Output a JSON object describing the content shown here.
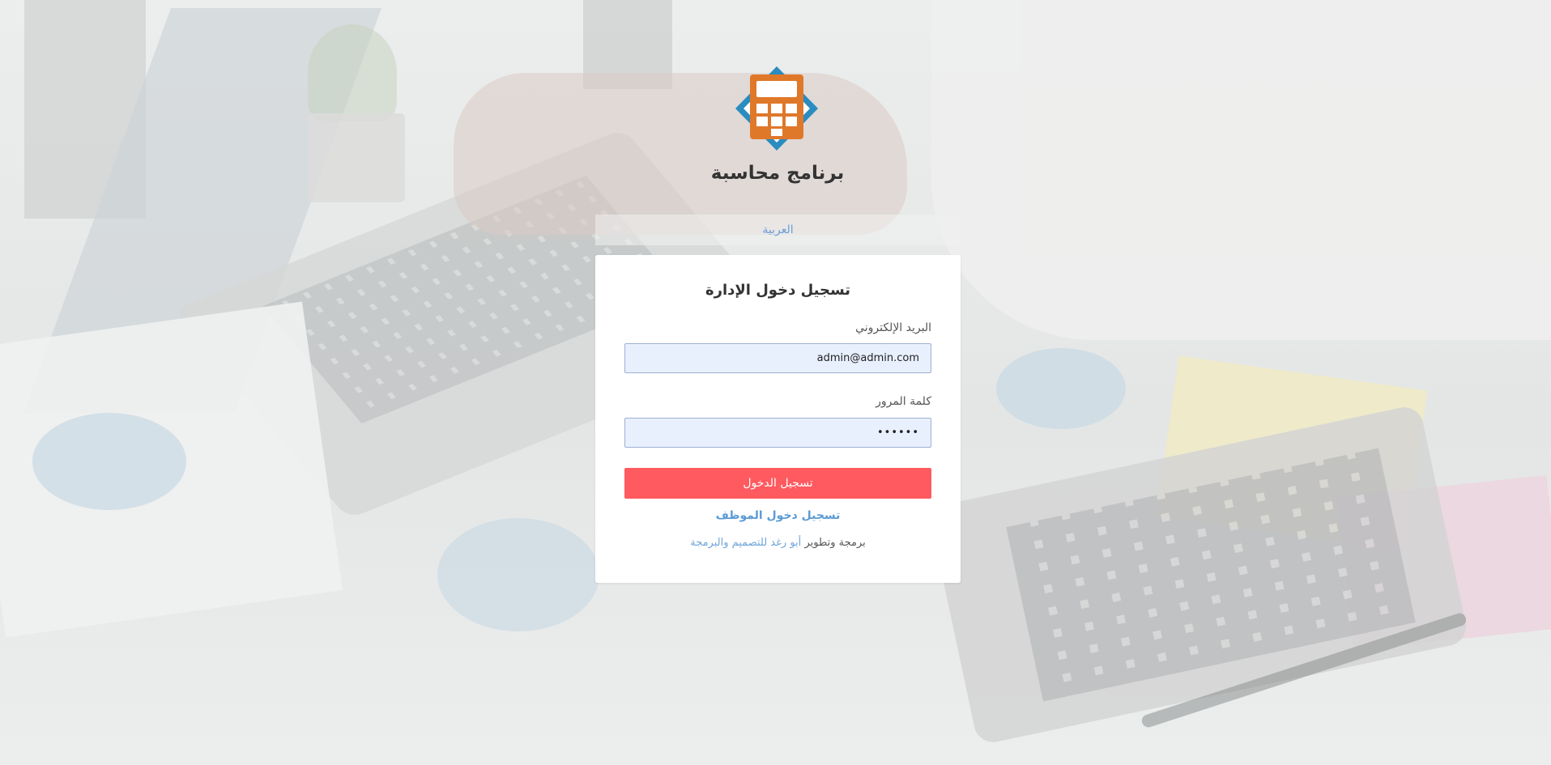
{
  "app": {
    "title": "برنامج محاسبة"
  },
  "language": {
    "current": "العربية"
  },
  "login": {
    "heading": "تسجيل دخول الإدارة",
    "email_label": "البريد الإلكتروني",
    "email_value": "admin@admin.com",
    "password_label": "كلمة المرور",
    "password_value": "••••••",
    "submit_label": "تسجيل الدخول",
    "employee_login_link": "تسجيل دخول الموظف"
  },
  "footer": {
    "prefix": "برمجة وتطوير",
    "developer_link": "أبو رغد للتصميم والبرمجة"
  },
  "colors": {
    "accent": "#ff5a5f",
    "link": "#5b9bd5",
    "logo_orange": "#e0782a",
    "logo_blue": "#2a8cbf"
  },
  "icons": {
    "logo": "calculator-icon"
  }
}
